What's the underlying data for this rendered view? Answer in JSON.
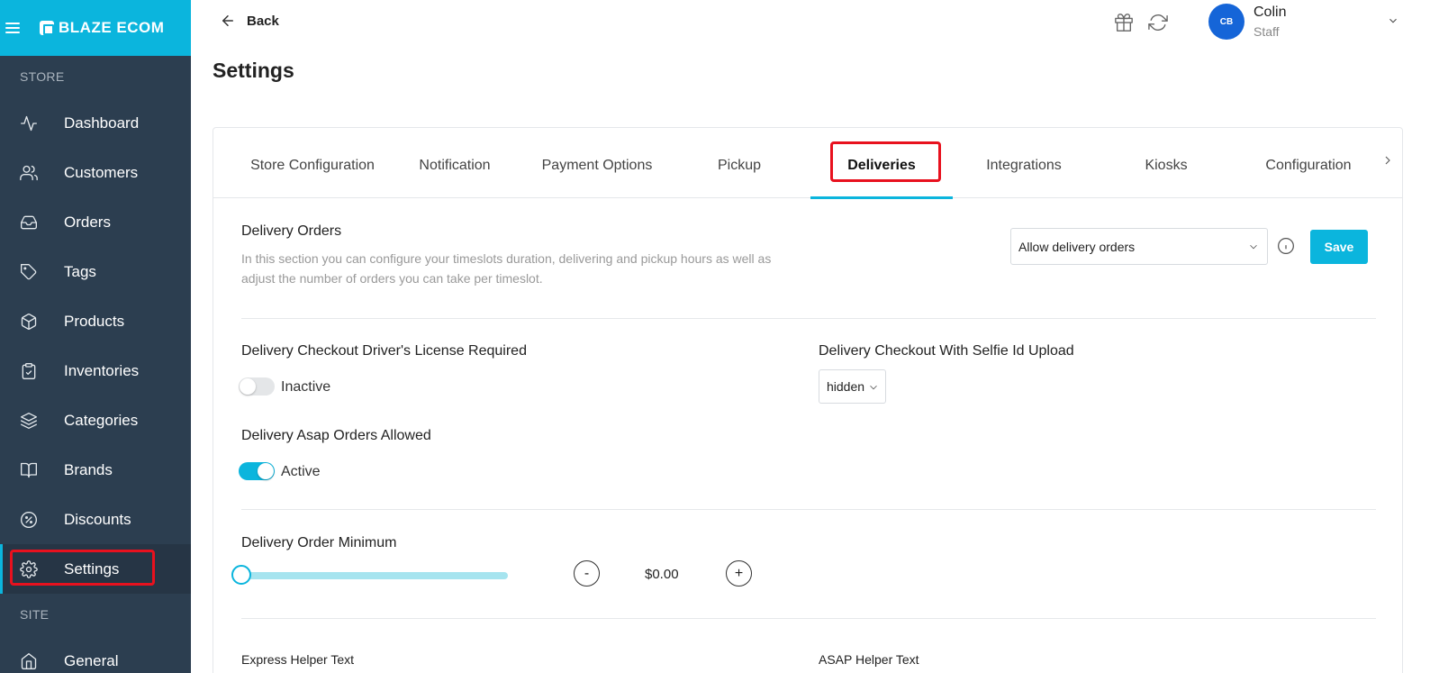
{
  "sidebar": {
    "brand": "BLAZE ECOM",
    "store_section": "STORE",
    "items": [
      {
        "label": "Dashboard",
        "icon": "activity-icon"
      },
      {
        "label": "Customers",
        "icon": "users-icon"
      },
      {
        "label": "Orders",
        "icon": "inbox-icon"
      },
      {
        "label": "Tags",
        "icon": "tag-icon"
      },
      {
        "label": "Products",
        "icon": "box-icon"
      },
      {
        "label": "Inventories",
        "icon": "clipboard-icon"
      },
      {
        "label": "Categories",
        "icon": "layers-icon"
      },
      {
        "label": "Brands",
        "icon": "book-icon"
      },
      {
        "label": "Discounts",
        "icon": "percent-icon"
      },
      {
        "label": "Settings",
        "icon": "gear-icon"
      }
    ],
    "site_section": "SITE",
    "site_items": [
      {
        "label": "General",
        "icon": "home-icon"
      }
    ]
  },
  "header": {
    "back_label": "Back",
    "user_initials": "CB",
    "user_name": "Colin",
    "user_role": "Staff"
  },
  "page": {
    "title": "Settings"
  },
  "tabs": [
    "Store Configuration",
    "Notification",
    "Payment Options",
    "Pickup",
    "Deliveries",
    "Integrations",
    "Kiosks",
    "Configuration"
  ],
  "active_tab": "Deliveries",
  "deliveries": {
    "section_title": "Delivery Orders",
    "section_desc_line1": "In this section you can configure your timeslots duration, delivering and pickup hours as well as",
    "section_desc_line2": "adjust the number of orders you can take per timeslot.",
    "delivery_mode_value": "Allow delivery orders",
    "save_label": "Save",
    "license_label": "Delivery Checkout Driver's License Required",
    "license_state": "Inactive",
    "selfie_label": "Delivery Checkout With Selfie Id Upload",
    "selfie_value": "hidden",
    "asap_label": "Delivery Asap Orders Allowed",
    "asap_state": "Active",
    "minimum_label": "Delivery Order Minimum",
    "minimum_value": "$0.00",
    "minimum_slider_fraction": 0,
    "minus_label": "-",
    "plus_label": "+",
    "express_helper_label": "Express Helper Text",
    "asap_helper_label": "ASAP Helper Text"
  },
  "colors": {
    "sidebar_bg": "#2c3e50",
    "accent": "#0bb5dd",
    "highlight": "#e8111e",
    "avatar": "#1565d8"
  }
}
